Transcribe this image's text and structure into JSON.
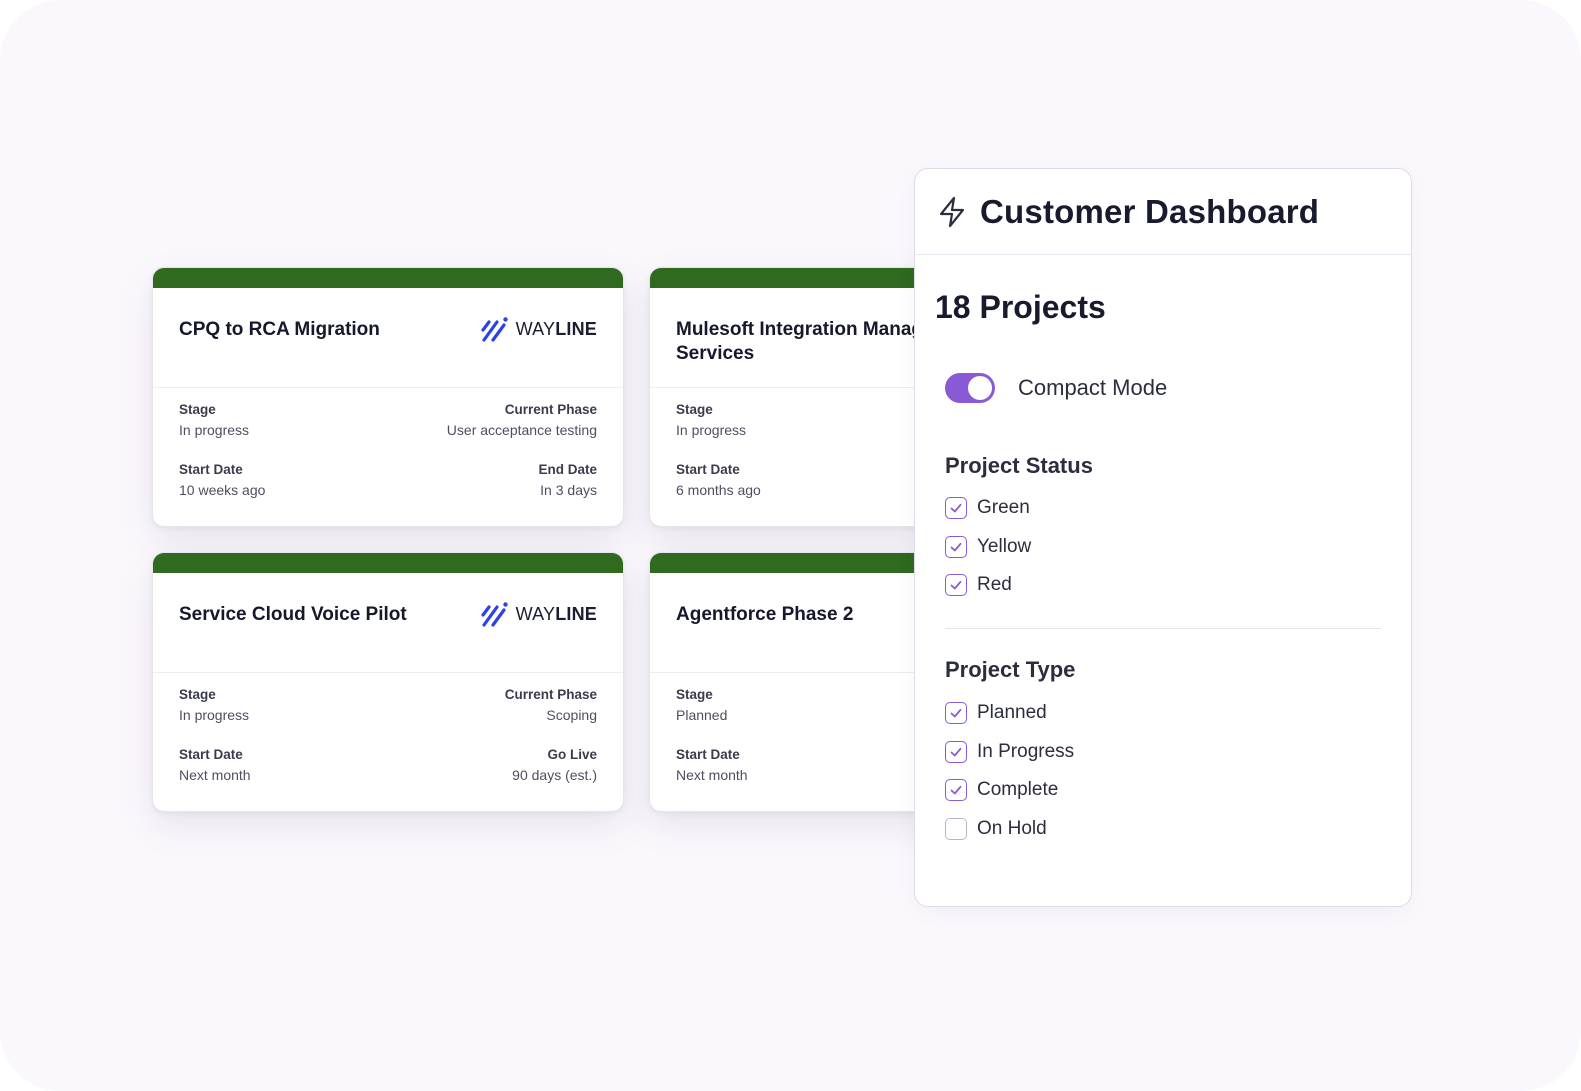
{
  "cards": [
    {
      "title": "CPQ to RCA Migration",
      "logo": {
        "prefix": "WAY",
        "suffix": "LINE"
      },
      "stage_label": "Stage",
      "stage_value": "In progress",
      "right1_label": "Current Phase",
      "right1_value": "User acceptance testing",
      "start_label": "Start Date",
      "start_value": "10 weeks ago",
      "right2_label": "End Date",
      "right2_value": "In 3 days"
    },
    {
      "title": "Mulesoft Integration Managed Services",
      "stage_label": "Stage",
      "stage_value": "In progress",
      "start_label": "Start Date",
      "start_value": "6 months ago"
    },
    {
      "title": "Service Cloud Voice Pilot",
      "logo": {
        "prefix": "WAY",
        "suffix": "LINE"
      },
      "stage_label": "Stage",
      "stage_value": "In progress",
      "right1_label": "Current Phase",
      "right1_value": "Scoping",
      "start_label": "Start Date",
      "start_value": "Next month",
      "right2_label": "Go Live",
      "right2_value": "90 days (est.)"
    },
    {
      "title": "Agentforce Phase 2",
      "stage_label": "Stage",
      "stage_value": "Planned",
      "start_label": "Start Date",
      "start_value": "Next month"
    }
  ],
  "panel": {
    "icon": "bolt-icon",
    "title": "Customer Dashboard",
    "count": "18 Projects",
    "compact_mode": {
      "label": "Compact Mode",
      "enabled": true
    },
    "status": {
      "title": "Project Status",
      "items": [
        {
          "label": "Green",
          "checked": true
        },
        {
          "label": "Yellow",
          "checked": true
        },
        {
          "label": "Red",
          "checked": true
        }
      ]
    },
    "type": {
      "title": "Project Type",
      "items": [
        {
          "label": "Planned",
          "checked": true
        },
        {
          "label": "In Progress",
          "checked": true
        },
        {
          "label": "Complete",
          "checked": true
        },
        {
          "label": "On Hold",
          "checked": false
        }
      ]
    }
  },
  "colors": {
    "card_band": "#2f6a1e",
    "accent": "#8a5ad6",
    "logo_blue": "#2b43e6",
    "background": "#fbf8fd"
  }
}
